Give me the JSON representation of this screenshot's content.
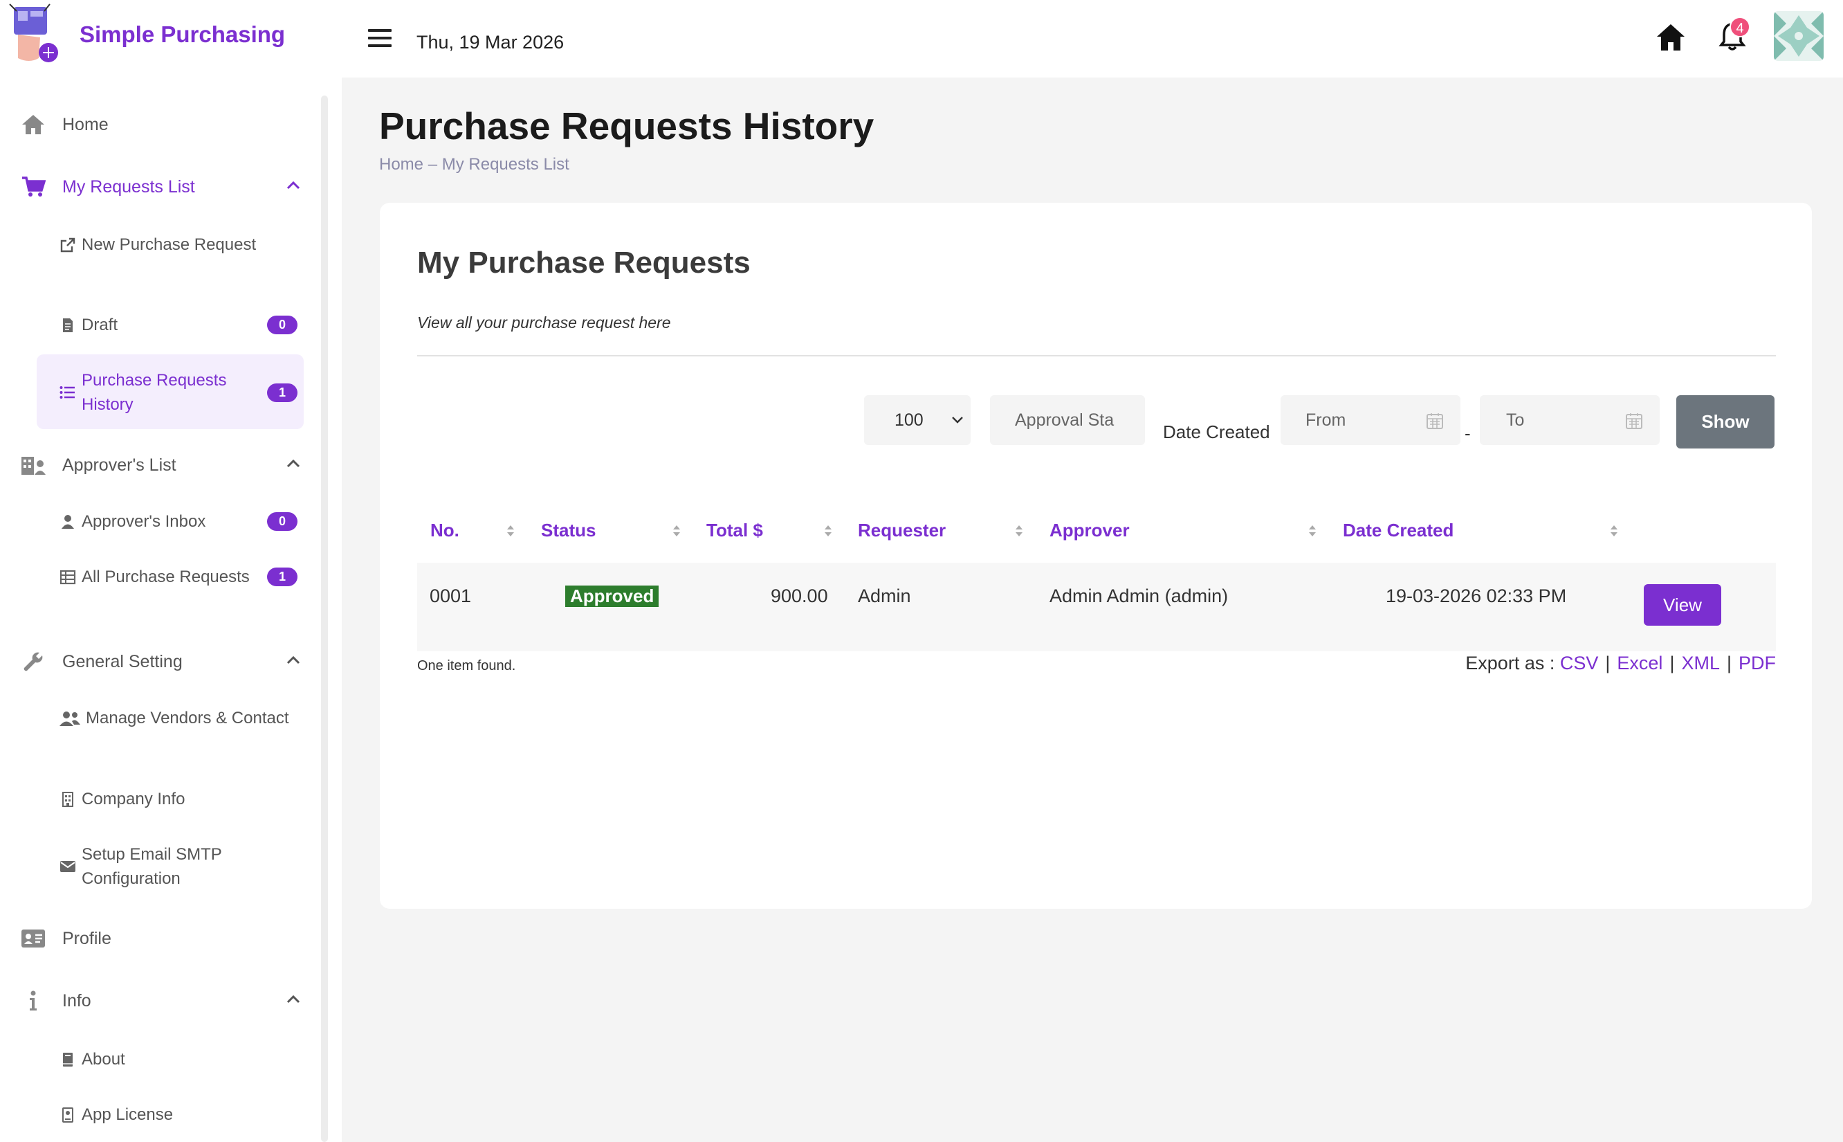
{
  "header": {
    "brand": "Simple Purchasing",
    "date": "Thu, 19 Mar 2026",
    "notification_count": "4",
    "accent": "#7b2fd0"
  },
  "sidebar": {
    "home": "Home",
    "my_requests": {
      "label": "My Requests List",
      "items": [
        {
          "label": "New Purchase Request",
          "icon": "external-link-icon"
        },
        {
          "label": "Draft",
          "badge": "0",
          "icon": "file-icon"
        },
        {
          "label": "Purchase Requests History",
          "badge": "1",
          "icon": "list-icon"
        }
      ]
    },
    "approvers": {
      "label": "Approver's List",
      "items": [
        {
          "label": "Approver's Inbox",
          "badge": "0",
          "icon": "user-icon"
        },
        {
          "label": "All Purchase Requests",
          "badge": "1",
          "icon": "table-icon"
        }
      ]
    },
    "general": {
      "label": "General Setting",
      "items": [
        {
          "label": "Manage Vendors & Contact",
          "icon": "people-icon"
        },
        {
          "label": "Company Info",
          "icon": "building-icon"
        },
        {
          "label": "Setup Email SMTP Configuration",
          "icon": "envelope-icon"
        }
      ]
    },
    "profile": "Profile",
    "info": {
      "label": "Info",
      "items": [
        {
          "label": "About",
          "icon": "book-icon"
        },
        {
          "label": "App License",
          "icon": "license-icon"
        }
      ]
    }
  },
  "page": {
    "title": "Purchase Requests History",
    "breadcrumb_home": "Home",
    "breadcrumb_sep": "–",
    "breadcrumb_current": "My Requests List"
  },
  "card": {
    "title": "My Purchase Requests",
    "subtitle": "View all your purchase request here",
    "filters": {
      "page_size": "100",
      "status_placeholder": "Approval Sta",
      "date_label": "Date Created",
      "from_placeholder": "From",
      "to_placeholder": "To",
      "dash": "-",
      "show_button": "Show"
    },
    "table": {
      "columns": [
        "No.",
        "Status",
        "Total $",
        "Requester",
        "Approver",
        "Date Created"
      ],
      "rows": [
        {
          "no": "0001",
          "status": "Approved",
          "total": "900.00",
          "requester": "Admin",
          "approver": "Admin Admin (admin)",
          "date": "19-03-2026 02:33 PM",
          "action": "View"
        }
      ]
    },
    "found_text": "One item found.",
    "export_label": "Export as :",
    "export_formats": [
      "CSV",
      "Excel",
      "XML",
      "PDF"
    ]
  }
}
